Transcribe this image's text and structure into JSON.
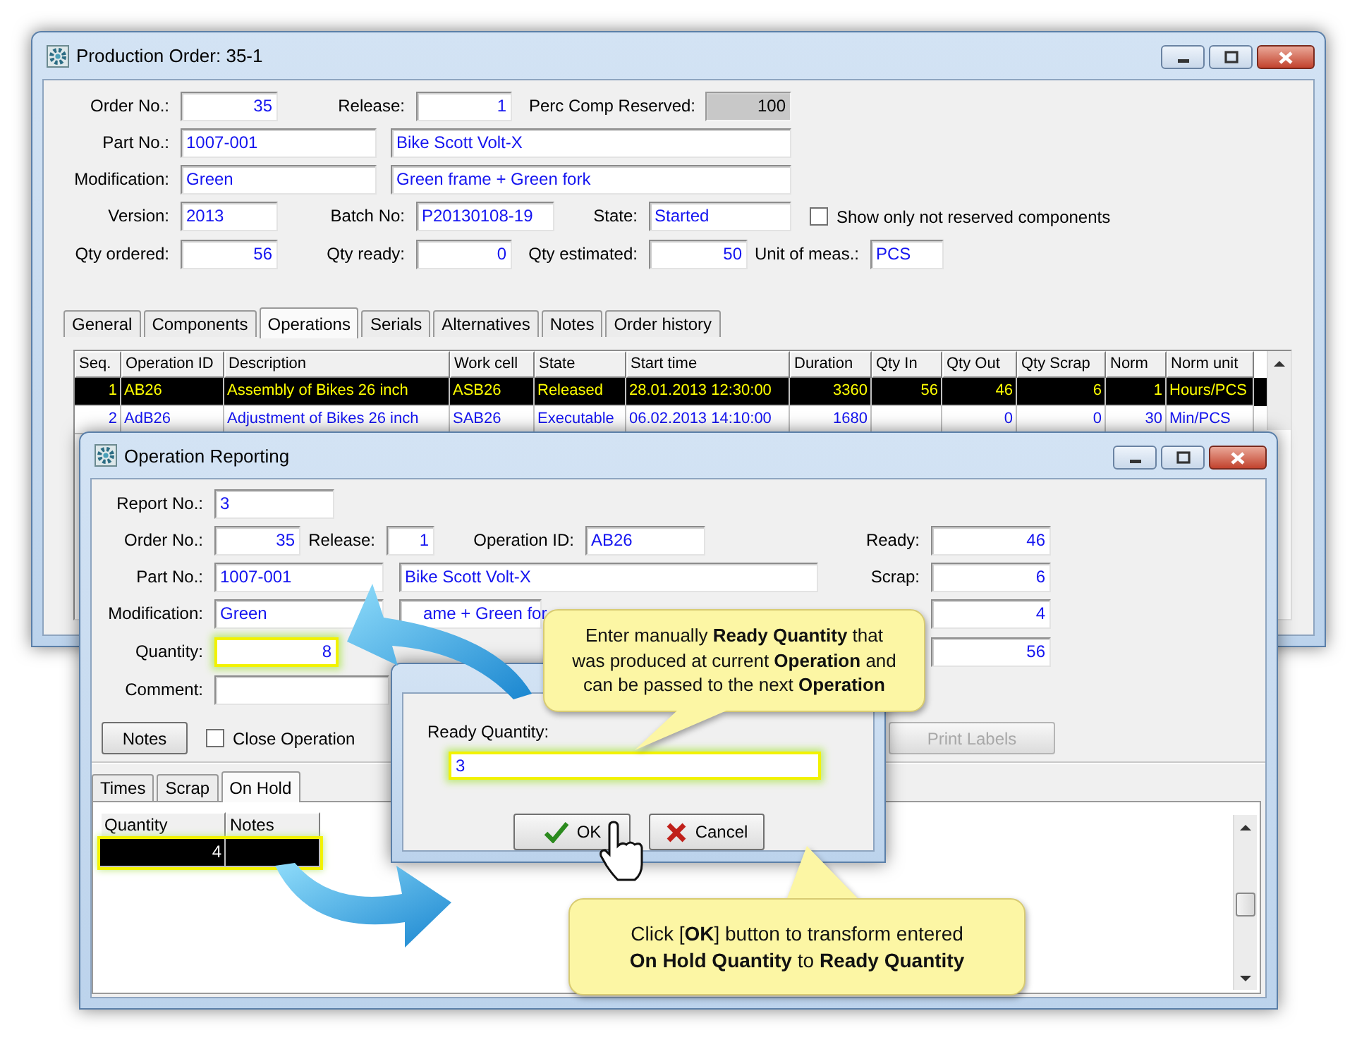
{
  "production_order_window": {
    "title": "Production Order: 35-1",
    "form_rows": [
      [
        {
          "kind": "label",
          "text": "Order No.:"
        },
        {
          "kind": "number",
          "value": "35"
        },
        {
          "kind": "label",
          "text": "Release:"
        },
        {
          "kind": "number",
          "value": "1"
        },
        {
          "kind": "label",
          "text": "Perc Comp Reserved:"
        },
        {
          "kind": "readonly",
          "value": "100"
        }
      ],
      [
        {
          "kind": "label",
          "text": "Part No.:"
        },
        {
          "kind": "text",
          "value": "1007-001"
        },
        {
          "kind": "text",
          "value": "Bike Scott Volt-X"
        }
      ],
      [
        {
          "kind": "label",
          "text": "Modification:"
        },
        {
          "kind": "text",
          "value": "Green"
        },
        {
          "kind": "text",
          "value": "Green frame + Green fork"
        }
      ],
      [
        {
          "kind": "label",
          "text": "Version:"
        },
        {
          "kind": "text",
          "value": "2013"
        },
        {
          "kind": "label",
          "text": "Batch No:"
        },
        {
          "kind": "text",
          "value": "P20130108-19"
        },
        {
          "kind": "label",
          "text": "State:"
        },
        {
          "kind": "text",
          "value": "Started"
        },
        {
          "kind": "checkbox",
          "label": "Show only not reserved components",
          "checked": false
        }
      ],
      [
        {
          "kind": "label",
          "text": "Qty ordered:"
        },
        {
          "kind": "number",
          "value": "56"
        },
        {
          "kind": "label",
          "text": "Qty ready:"
        },
        {
          "kind": "number",
          "value": "0"
        },
        {
          "kind": "label",
          "text": "Qty estimated:"
        },
        {
          "kind": "number",
          "value": "50"
        },
        {
          "kind": "label",
          "text": "Unit of meas.:"
        },
        {
          "kind": "text",
          "value": "PCS"
        }
      ]
    ],
    "tabs": [
      {
        "label": "General",
        "selected": false
      },
      {
        "label": "Components",
        "selected": false
      },
      {
        "label": "Operations",
        "selected": true
      },
      {
        "label": "Serials",
        "selected": false
      },
      {
        "label": "Alternatives",
        "selected": false
      },
      {
        "label": "Notes",
        "selected": false
      },
      {
        "label": "Order history",
        "selected": false
      }
    ],
    "table": {
      "columns": [
        "Seq.",
        "Operation ID",
        "Description",
        "Work cell",
        "State",
        "Start time",
        "Duration",
        "Qty In",
        "Qty Out",
        "Qty Scrap",
        "Norm",
        "Norm unit"
      ],
      "rows": [
        {
          "selected": true,
          "cells": [
            "1",
            "AB26",
            "Assembly of Bikes 26 inch",
            "ASB26",
            "Released",
            "28.01.2013 12:30:00",
            "3360",
            "56",
            "46",
            "6",
            "1",
            "Hours/PCS"
          ]
        },
        {
          "selected": false,
          "cells": [
            "2",
            "AdB26",
            "Adjustment of Bikes 26 inch",
            "SAB26",
            "Executable",
            "06.02.2013 14:10:00",
            "1680",
            null,
            "0",
            "0",
            "30",
            "Min/PCS"
          ]
        }
      ]
    }
  },
  "operation_reporting_window": {
    "title": "Operation Reporting",
    "form_rows": [
      [
        {
          "kind": "label",
          "text": "Report No.:"
        },
        {
          "kind": "text",
          "value": "3"
        }
      ],
      [
        {
          "kind": "label",
          "text": "Order No.:"
        },
        {
          "kind": "number",
          "value": "35"
        },
        {
          "kind": "label",
          "text": "Release:"
        },
        {
          "kind": "number",
          "value": "1"
        },
        {
          "kind": "label",
          "text": "Operation ID:"
        },
        {
          "kind": "text",
          "value": "AB26"
        },
        {
          "kind": "label",
          "text": "Ready:"
        },
        {
          "kind": "number",
          "value": "46"
        }
      ],
      [
        {
          "kind": "label",
          "text": "Part No.:"
        },
        {
          "kind": "text",
          "value": "1007-001"
        },
        {
          "kind": "text",
          "value": "Bike Scott Volt-X"
        },
        {
          "kind": "label",
          "text": "Scrap:"
        },
        {
          "kind": "number",
          "value": "6"
        }
      ],
      [
        {
          "kind": "label",
          "text": "Modification:"
        },
        {
          "kind": "text",
          "value": "Green"
        },
        {
          "kind": "text",
          "value": "ame + Green for"
        },
        {
          "kind": "number",
          "value": "4"
        }
      ],
      [
        {
          "kind": "label",
          "text": "Quantity:"
        },
        {
          "kind": "number",
          "value": "8",
          "highlighted": true
        },
        {
          "kind": "number",
          "value": "56"
        }
      ],
      [
        {
          "kind": "label",
          "text": "Comment:"
        },
        {
          "kind": "text"
        }
      ],
      [
        {
          "kind": "button",
          "label": "Notes",
          "disabled": false
        },
        {
          "kind": "checkbox",
          "label": "Close Operation",
          "checked": false
        },
        {
          "kind": "button",
          "label": "Print Labels",
          "disabled": true
        }
      ]
    ],
    "tabs": [
      {
        "label": "Times",
        "selected": false
      },
      {
        "label": "Scrap",
        "selected": false
      },
      {
        "label": "On Hold",
        "selected": true
      }
    ],
    "grid": {
      "columns": [
        "Quantity",
        "Notes"
      ],
      "rows": [
        {
          "selected": true,
          "highlighted": true,
          "cells": [
            "4",
            null
          ]
        }
      ]
    }
  },
  "ready_quantity_dialog": {
    "label": "Ready Quantity:",
    "field": {
      "value": "3",
      "highlighted": true
    },
    "buttons": [
      {
        "kind": "ok",
        "label": "OK"
      },
      {
        "kind": "cancel",
        "label": "Cancel"
      }
    ]
  },
  "callouts": [
    {
      "text": "Enter manually **Ready Quantity** that\nwas produced at current **Operation** and\ncan be passed to the next **Operation**"
    },
    {
      "text": "Click [**OK**] button to transform entered\n**On Hold Quantity** to **Ready Quantity**"
    }
  ]
}
